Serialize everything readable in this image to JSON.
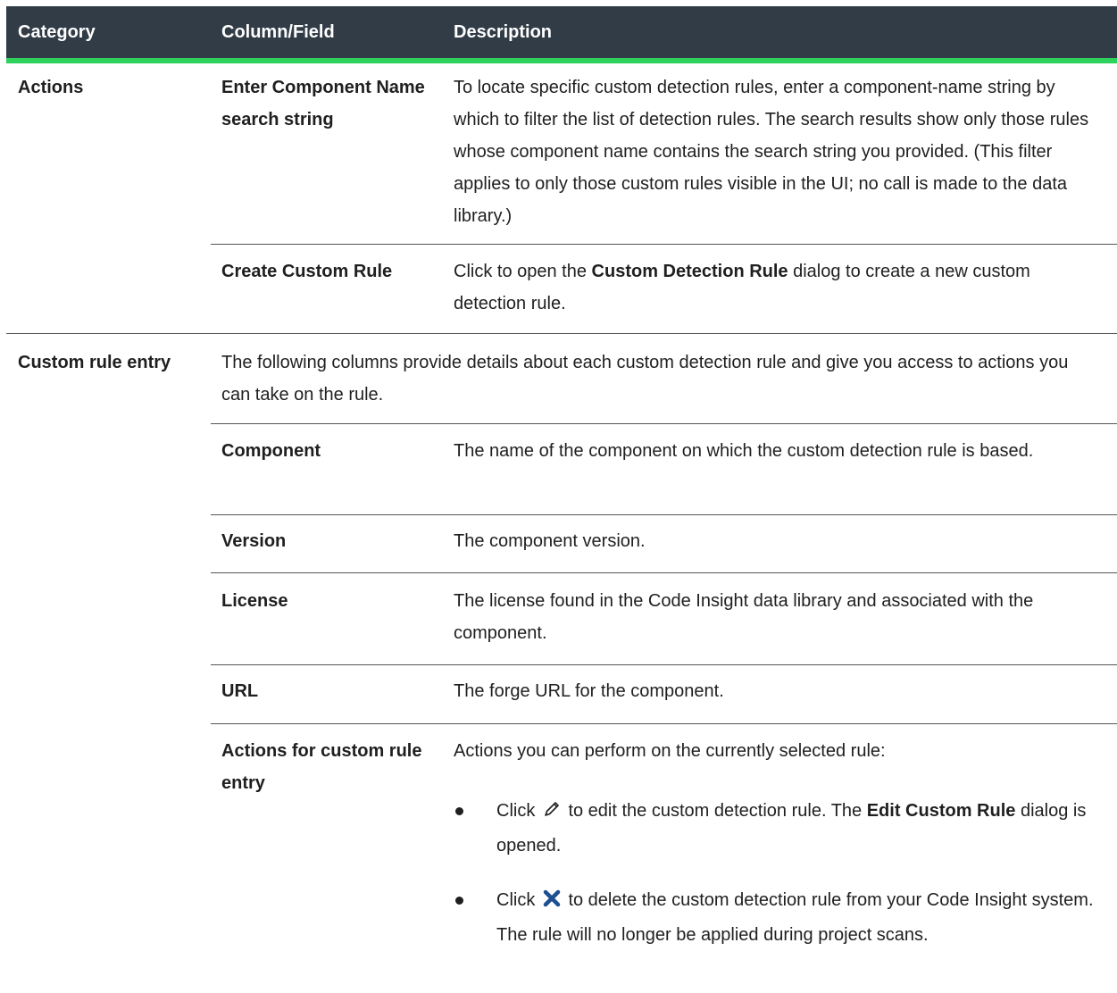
{
  "header": {
    "category": "Category",
    "column_field": "Column/Field",
    "description": "Description"
  },
  "actions": {
    "category": "Actions",
    "rows": [
      {
        "field": "Enter Component Name search string",
        "description": "To locate specific custom detection rules, enter a component-name string by which to filter the list of detection rules. The search results show only those rules whose component name contains the search string you provided. (This filter applies to only those custom rules visible in the UI; no call is made to the data library.)"
      },
      {
        "field": "Create Custom Rule",
        "desc_pre": "Click to open the ",
        "desc_bold": "Custom Detection Rule",
        "desc_post": " dialog to create a new custom detection rule."
      }
    ]
  },
  "custom_rule": {
    "category": "Custom rule entry",
    "intro": "The following columns provide details about each custom detection rule and give you access to actions you can take on the rule.",
    "rows": [
      {
        "field": "Component",
        "description": "The name of the component on which the custom detection rule is based."
      },
      {
        "field": "Version",
        "description": "The component version."
      },
      {
        "field": "License",
        "description": "The license found in the Code Insight data library and associated with the component."
      },
      {
        "field": "URL",
        "description": "The forge URL for the component."
      }
    ],
    "actions_row": {
      "field": "Actions for custom rule entry",
      "description": "Actions you can perform on the currently selected rule:",
      "bullets": [
        {
          "pre": "Click ",
          "icon": "pencil-icon",
          "mid": " to edit the custom detection rule. The ",
          "bold": "Edit Custom Rule",
          "post": " dialog is opened."
        },
        {
          "pre": "Click ",
          "icon": "x-icon",
          "mid": " to delete the custom detection rule from your Code Insight system. The rule will no longer be applied during project scans."
        }
      ]
    }
  },
  "colors": {
    "header_bg": "#323c46",
    "header_rule": "#2ed15c",
    "delete_icon": "#1d4f91"
  }
}
